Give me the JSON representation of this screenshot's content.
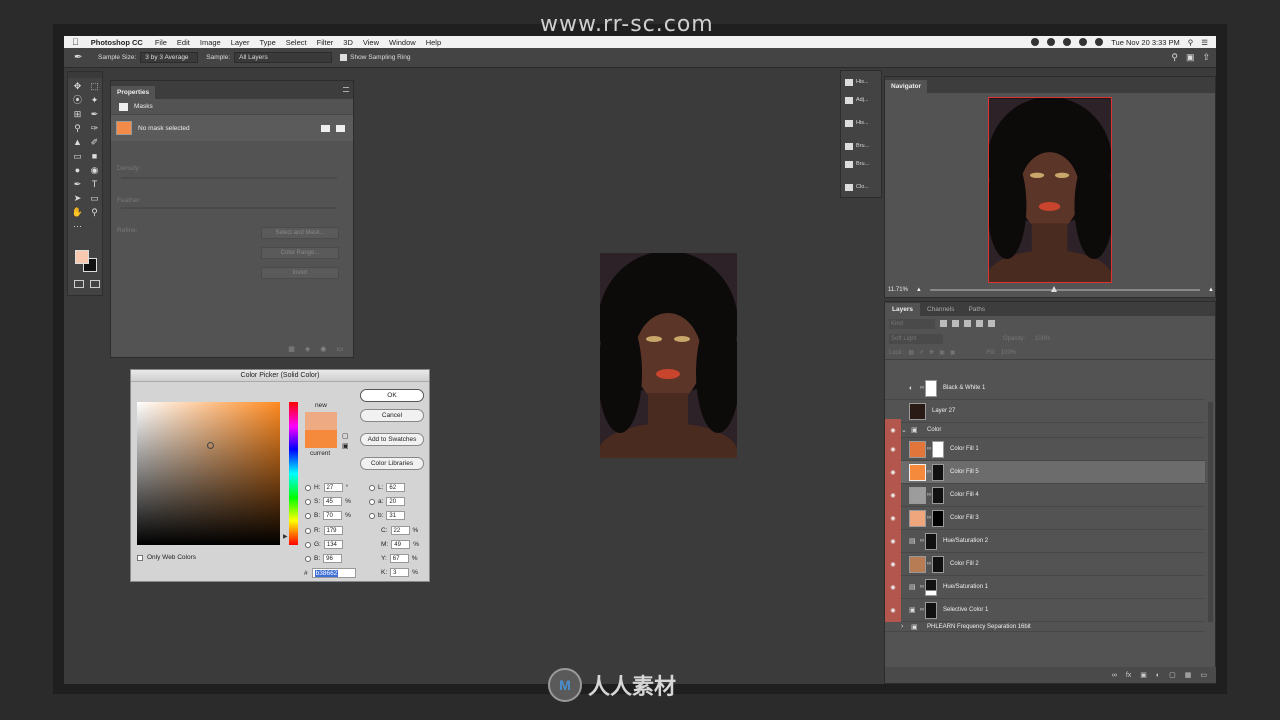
{
  "watermark": "www.rr-sc.com",
  "bottom_logo": "人人素材",
  "menubar": {
    "app": "Photoshop CC",
    "items": [
      "File",
      "Edit",
      "Image",
      "Layer",
      "Type",
      "Select",
      "Filter",
      "3D",
      "View",
      "Window",
      "Help"
    ],
    "clock": "Tue Nov 20  3:33 PM"
  },
  "options": {
    "sample_size_label": "Sample Size:",
    "sample_size_value": "3 by 3 Average",
    "sample_label": "Sample:",
    "sample_value": "All Layers",
    "show_ring": "Show Sampling Ring"
  },
  "properties": {
    "tab": "Properties",
    "section": "Masks",
    "mask_status": "No mask selected",
    "density": "Density:",
    "feather": "Feather:",
    "refine": "Refine:",
    "btn_select_mask": "Select and Mask...",
    "btn_color_range": "Color Range...",
    "btn_invert": "Invert"
  },
  "picker": {
    "title": "Color Picker (Solid Color)",
    "new_label": "new",
    "current_label": "current",
    "ok": "OK",
    "cancel": "Cancel",
    "add_swatches": "Add to Swatches",
    "libraries": "Color Libraries",
    "web_only": "Only Web Colors",
    "H": "27",
    "S": "45",
    "B": "70",
    "R": "179",
    "G": "134",
    "Bv": "96",
    "L": "62",
    "a": "20",
    "b": "31",
    "C": "22",
    "M": "49",
    "Y": "67",
    "K": "3",
    "hex": "b38662",
    "deg": "°",
    "pct": "%"
  },
  "collapsed_panels": [
    "His...",
    "Adj...",
    "His...",
    "Bru...",
    "Bru...",
    "Clo..."
  ],
  "navigator": {
    "tab": "Navigator",
    "zoom": "11.71%"
  },
  "layers_panel": {
    "tabs": [
      "Layers",
      "Channels",
      "Paths"
    ],
    "kind": "Kind",
    "blend": "Soft Light",
    "opacity_label": "Opacity:",
    "opacity_value": "100%",
    "lock_label": "Lock:",
    "fill_label": "Fill:",
    "fill_value": "100%",
    "rows": [
      {
        "name": "Black & White 1"
      },
      {
        "name": "Layer 27"
      },
      {
        "name": "Color"
      },
      {
        "name": "Color Fill 1"
      },
      {
        "name": "Color Fill 5"
      },
      {
        "name": "Color Fill 4"
      },
      {
        "name": "Color Fill 3"
      },
      {
        "name": "Hue/Saturation 2"
      },
      {
        "name": "Color Fill 2"
      },
      {
        "name": "Hue/Saturation 1"
      },
      {
        "name": "Selective Color 1"
      },
      {
        "name": "PHLEARN Frequency Separation 16bit"
      }
    ]
  },
  "colors": {
    "accent_orange": "#f58a3c",
    "new_color": "#eeab83",
    "layer_red": "#b3564d",
    "panel": "#535353"
  }
}
